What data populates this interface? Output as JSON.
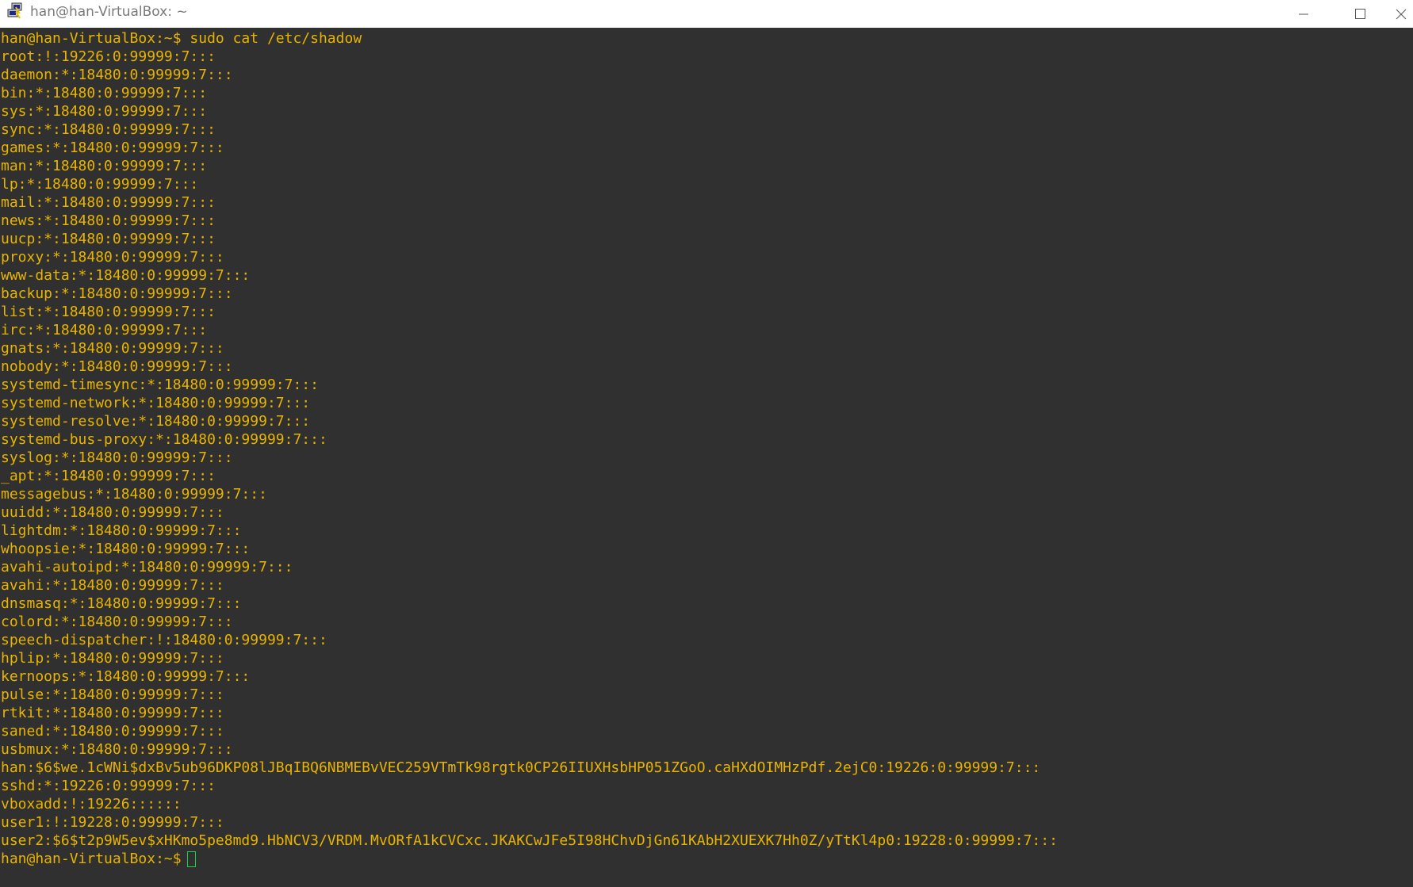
{
  "window": {
    "title": "han@han-VirtualBox: ~",
    "icon": "putty-terminal-icon",
    "controls": [
      "minimize-icon",
      "maximize-icon",
      "close-icon"
    ]
  },
  "colors": {
    "terminal_bg": "#303030",
    "text": "#e8b400",
    "cursor": "#19d34a",
    "titlebar_bg": "#ffffff"
  },
  "terminal": {
    "lines": [
      "han@han-VirtualBox:~$ sudo cat /etc/shadow",
      "root:!:19226:0:99999:7:::",
      "daemon:*:18480:0:99999:7:::",
      "bin:*:18480:0:99999:7:::",
      "sys:*:18480:0:99999:7:::",
      "sync:*:18480:0:99999:7:::",
      "games:*:18480:0:99999:7:::",
      "man:*:18480:0:99999:7:::",
      "lp:*:18480:0:99999:7:::",
      "mail:*:18480:0:99999:7:::",
      "news:*:18480:0:99999:7:::",
      "uucp:*:18480:0:99999:7:::",
      "proxy:*:18480:0:99999:7:::",
      "www-data:*:18480:0:99999:7:::",
      "backup:*:18480:0:99999:7:::",
      "list:*:18480:0:99999:7:::",
      "irc:*:18480:0:99999:7:::",
      "gnats:*:18480:0:99999:7:::",
      "nobody:*:18480:0:99999:7:::",
      "systemd-timesync:*:18480:0:99999:7:::",
      "systemd-network:*:18480:0:99999:7:::",
      "systemd-resolve:*:18480:0:99999:7:::",
      "systemd-bus-proxy:*:18480:0:99999:7:::",
      "syslog:*:18480:0:99999:7:::",
      "_apt:*:18480:0:99999:7:::",
      "messagebus:*:18480:0:99999:7:::",
      "uuidd:*:18480:0:99999:7:::",
      "lightdm:*:18480:0:99999:7:::",
      "whoopsie:*:18480:0:99999:7:::",
      "avahi-autoipd:*:18480:0:99999:7:::",
      "avahi:*:18480:0:99999:7:::",
      "dnsmasq:*:18480:0:99999:7:::",
      "colord:*:18480:0:99999:7:::",
      "speech-dispatcher:!:18480:0:99999:7:::",
      "hplip:*:18480:0:99999:7:::",
      "kernoops:*:18480:0:99999:7:::",
      "pulse:*:18480:0:99999:7:::",
      "rtkit:*:18480:0:99999:7:::",
      "saned:*:18480:0:99999:7:::",
      "usbmux:*:18480:0:99999:7:::",
      "han:$6$we.1cWNi$dxBv5ub96DKP08lJBqIBQ6NBMEBvVEC259VTmTk98rgtk0CP26IIUXHsbHP051ZGoO.caHXdOIMHzPdf.2ejC0:19226:0:99999:7:::",
      "sshd:*:19226:0:99999:7:::",
      "vboxadd:!:19226::::::",
      "user1:!:19228:0:99999:7:::",
      "user2:$6$t2p9W5ev$xHKmo5pe8md9.HbNCV3/VRDM.MvORfA1kCVCxc.JKAKCwJFe5I98HChvDjGn61KAbH2XUEXK7Hh0Z/yTtKl4p0:19228:0:99999:7:::"
    ],
    "prompt": "han@han-VirtualBox:~$"
  }
}
